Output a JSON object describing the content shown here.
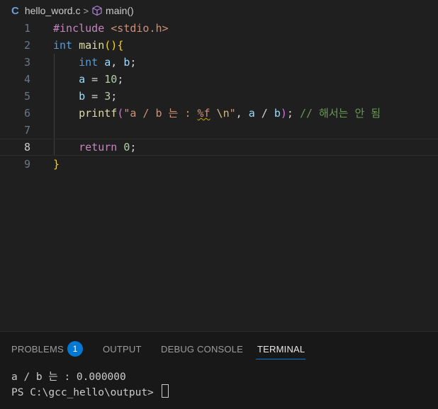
{
  "breadcrumb": {
    "file_icon": "C",
    "file": "hello_word.c",
    "separator": ">",
    "symbol_icon": "cube-icon",
    "symbol": "main()"
  },
  "editor": {
    "current_line": 8,
    "lines": [
      {
        "n": "1",
        "tokens": [
          [
            "kw-include",
            "#include "
          ],
          [
            "str",
            "<stdio.h>"
          ]
        ]
      },
      {
        "n": "2",
        "tokens": [
          [
            "type",
            "int"
          ],
          [
            "plain",
            " "
          ],
          [
            "fn",
            "main"
          ],
          [
            "br1",
            "()"
          ],
          [
            "br1",
            "{"
          ]
        ]
      },
      {
        "n": "3",
        "tokens": [
          [
            "plain",
            "    "
          ],
          [
            "type",
            "int"
          ],
          [
            "plain",
            " "
          ],
          [
            "var",
            "a"
          ],
          [
            "plain",
            ", "
          ],
          [
            "var",
            "b"
          ],
          [
            "plain",
            ";"
          ]
        ]
      },
      {
        "n": "4",
        "tokens": [
          [
            "plain",
            "    "
          ],
          [
            "var",
            "a"
          ],
          [
            "plain",
            " = "
          ],
          [
            "num",
            "10"
          ],
          [
            "plain",
            ";"
          ]
        ]
      },
      {
        "n": "5",
        "tokens": [
          [
            "plain",
            "    "
          ],
          [
            "var",
            "b"
          ],
          [
            "plain",
            " = "
          ],
          [
            "num",
            "3"
          ],
          [
            "plain",
            ";"
          ]
        ]
      },
      {
        "n": "6",
        "tokens": [
          [
            "plain",
            "    "
          ],
          [
            "fn",
            "printf"
          ],
          [
            "br2",
            "("
          ],
          [
            "str",
            "\"a / b 는 : "
          ],
          [
            "squig",
            "%f"
          ],
          [
            "str",
            " "
          ],
          [
            "esc",
            "\\n"
          ],
          [
            "str",
            "\""
          ],
          [
            "plain",
            ", "
          ],
          [
            "var",
            "a"
          ],
          [
            "plain",
            " / "
          ],
          [
            "var",
            "b"
          ],
          [
            "br2",
            ")"
          ],
          [
            "plain",
            "; "
          ],
          [
            "cmt",
            "// 해서는 안 됨"
          ]
        ]
      },
      {
        "n": "7",
        "tokens": []
      },
      {
        "n": "8",
        "tokens": [
          [
            "plain",
            "    "
          ],
          [
            "ctl",
            "return"
          ],
          [
            "plain",
            " "
          ],
          [
            "num",
            "0"
          ],
          [
            "plain",
            ";"
          ]
        ]
      },
      {
        "n": "9",
        "tokens": [
          [
            "br1",
            "}"
          ]
        ]
      }
    ]
  },
  "panel": {
    "tabs": {
      "problems": "PROBLEMS",
      "problems_count": "1",
      "output": "OUTPUT",
      "debug_console": "DEBUG CONSOLE",
      "terminal": "TERMINAL"
    },
    "active_tab": "TERMINAL",
    "terminal_lines": [
      "a / b 는 : 0.000000",
      "PS C:\\gcc_hello\\output> "
    ]
  },
  "colors": {
    "editor_bg": "#1f1f1f",
    "panel_bg": "#181818",
    "accent": "#0078d4"
  }
}
